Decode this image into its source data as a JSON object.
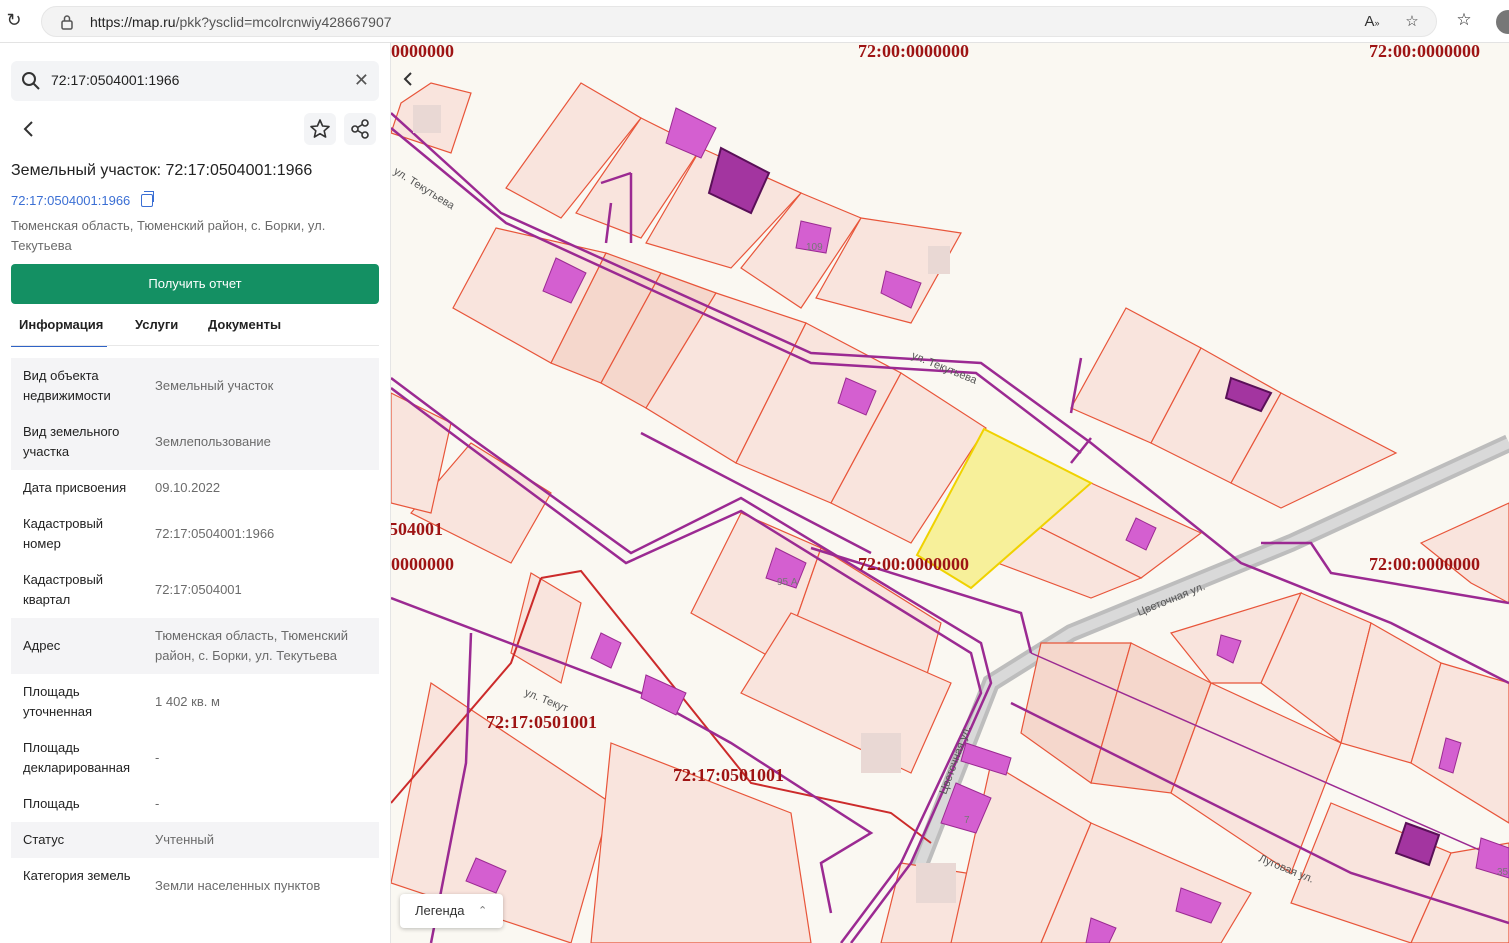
{
  "browser": {
    "url_host": "https://map.ru",
    "url_path": "/pkk?ysclid=mcolrcnwiy428667907"
  },
  "search": {
    "value": "72:17:0504001:1966",
    "clear": "✕"
  },
  "parcel": {
    "title": "Земельный участок: 72:17:0504001:1966",
    "cad_link": "72:17:0504001:1966",
    "address": "Тюменская область, Тюменский район, с. Борки, ул. Текутьева"
  },
  "actions": {
    "report_label": "Получить отчет"
  },
  "tabs": [
    {
      "label": "Информация",
      "active": true
    },
    {
      "label": "Услуги",
      "active": false
    },
    {
      "label": "Документы",
      "active": false
    }
  ],
  "info_rows": [
    {
      "key": "Вид объекта недвижимости",
      "value": "Земельный участок"
    },
    {
      "key": "Вид земельного участка",
      "value": "Землепользование"
    },
    {
      "key": "Дата присвоения",
      "value": "09.10.2022"
    },
    {
      "key": "Кадастровый номер",
      "value": "72:17:0504001:1966"
    },
    {
      "key": "Кадастровый квартал",
      "value": "72:17:0504001"
    },
    {
      "key": "Адрес",
      "value": "Тюменская область, Тюменский район, с. Борки, ул. Текутьева"
    },
    {
      "key": "Площадь уточненная",
      "value": "1 402 кв. м"
    },
    {
      "key": "Площадь декларированная",
      "value": "-"
    },
    {
      "key": "Площадь",
      "value": "-"
    },
    {
      "key": "Статус",
      "value": "Учтенный"
    },
    {
      "key": "Категория земель",
      "value": "Земли населенных пунктов"
    }
  ],
  "map": {
    "labels": {
      "q1": "72:00:0000000",
      "q2": "72:00:0000000",
      "q3": ":0000000",
      "q4": "72:00:0000000",
      "q5": "72:00:0000000",
      "q6": ":0000000",
      "q7": "504001",
      "q8": "72:17:0501001",
      "q9": "72:17:0501001"
    },
    "streets": {
      "s1": "ул. Текутьева",
      "s2": "ул. Текутьева",
      "s3": "ул. Текут",
      "s4": "Цветочная ул.",
      "s5": "Цветочная ул.",
      "s6": "Луговая ул."
    },
    "house_numbers": {
      "h1": "109",
      "h2": "95 А",
      "h3": "7",
      "h4": "35"
    },
    "legend_label": "Легенда",
    "colors": {
      "parcel_fill": "#f9e4dd",
      "parcel_stroke": "#e8553a",
      "selected_fill": "#f7f09a",
      "selected_stroke": "#f0d200",
      "boundary": "#9b2a92",
      "building": "#d45fd0",
      "road": "#b9b9b9",
      "quarter_label": "#9e1414"
    }
  }
}
